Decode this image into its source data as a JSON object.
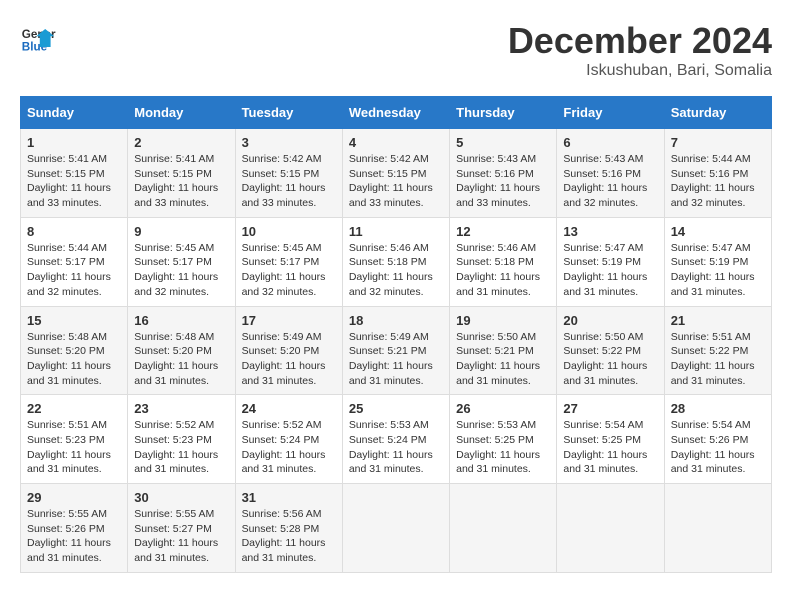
{
  "header": {
    "logo_line1": "General",
    "logo_line2": "Blue",
    "month": "December 2024",
    "location": "Iskushuban, Bari, Somalia"
  },
  "days_of_week": [
    "Sunday",
    "Monday",
    "Tuesday",
    "Wednesday",
    "Thursday",
    "Friday",
    "Saturday"
  ],
  "weeks": [
    [
      {
        "day": "1",
        "rise": "5:41 AM",
        "set": "5:15 PM",
        "hours": "11 hours and 33 minutes."
      },
      {
        "day": "2",
        "rise": "5:41 AM",
        "set": "5:15 PM",
        "hours": "11 hours and 33 minutes."
      },
      {
        "day": "3",
        "rise": "5:42 AM",
        "set": "5:15 PM",
        "hours": "11 hours and 33 minutes."
      },
      {
        "day": "4",
        "rise": "5:42 AM",
        "set": "5:15 PM",
        "hours": "11 hours and 33 minutes."
      },
      {
        "day": "5",
        "rise": "5:43 AM",
        "set": "5:16 PM",
        "hours": "11 hours and 33 minutes."
      },
      {
        "day": "6",
        "rise": "5:43 AM",
        "set": "5:16 PM",
        "hours": "11 hours and 32 minutes."
      },
      {
        "day": "7",
        "rise": "5:44 AM",
        "set": "5:16 PM",
        "hours": "11 hours and 32 minutes."
      }
    ],
    [
      {
        "day": "8",
        "rise": "5:44 AM",
        "set": "5:17 PM",
        "hours": "11 hours and 32 minutes."
      },
      {
        "day": "9",
        "rise": "5:45 AM",
        "set": "5:17 PM",
        "hours": "11 hours and 32 minutes."
      },
      {
        "day": "10",
        "rise": "5:45 AM",
        "set": "5:17 PM",
        "hours": "11 hours and 32 minutes."
      },
      {
        "day": "11",
        "rise": "5:46 AM",
        "set": "5:18 PM",
        "hours": "11 hours and 32 minutes."
      },
      {
        "day": "12",
        "rise": "5:46 AM",
        "set": "5:18 PM",
        "hours": "11 hours and 31 minutes."
      },
      {
        "day": "13",
        "rise": "5:47 AM",
        "set": "5:19 PM",
        "hours": "11 hours and 31 minutes."
      },
      {
        "day": "14",
        "rise": "5:47 AM",
        "set": "5:19 PM",
        "hours": "11 hours and 31 minutes."
      }
    ],
    [
      {
        "day": "15",
        "rise": "5:48 AM",
        "set": "5:20 PM",
        "hours": "11 hours and 31 minutes."
      },
      {
        "day": "16",
        "rise": "5:48 AM",
        "set": "5:20 PM",
        "hours": "11 hours and 31 minutes."
      },
      {
        "day": "17",
        "rise": "5:49 AM",
        "set": "5:20 PM",
        "hours": "11 hours and 31 minutes."
      },
      {
        "day": "18",
        "rise": "5:49 AM",
        "set": "5:21 PM",
        "hours": "11 hours and 31 minutes."
      },
      {
        "day": "19",
        "rise": "5:50 AM",
        "set": "5:21 PM",
        "hours": "11 hours and 31 minutes."
      },
      {
        "day": "20",
        "rise": "5:50 AM",
        "set": "5:22 PM",
        "hours": "11 hours and 31 minutes."
      },
      {
        "day": "21",
        "rise": "5:51 AM",
        "set": "5:22 PM",
        "hours": "11 hours and 31 minutes."
      }
    ],
    [
      {
        "day": "22",
        "rise": "5:51 AM",
        "set": "5:23 PM",
        "hours": "11 hours and 31 minutes."
      },
      {
        "day": "23",
        "rise": "5:52 AM",
        "set": "5:23 PM",
        "hours": "11 hours and 31 minutes."
      },
      {
        "day": "24",
        "rise": "5:52 AM",
        "set": "5:24 PM",
        "hours": "11 hours and 31 minutes."
      },
      {
        "day": "25",
        "rise": "5:53 AM",
        "set": "5:24 PM",
        "hours": "11 hours and 31 minutes."
      },
      {
        "day": "26",
        "rise": "5:53 AM",
        "set": "5:25 PM",
        "hours": "11 hours and 31 minutes."
      },
      {
        "day": "27",
        "rise": "5:54 AM",
        "set": "5:25 PM",
        "hours": "11 hours and 31 minutes."
      },
      {
        "day": "28",
        "rise": "5:54 AM",
        "set": "5:26 PM",
        "hours": "11 hours and 31 minutes."
      }
    ],
    [
      {
        "day": "29",
        "rise": "5:55 AM",
        "set": "5:26 PM",
        "hours": "11 hours and 31 minutes."
      },
      {
        "day": "30",
        "rise": "5:55 AM",
        "set": "5:27 PM",
        "hours": "11 hours and 31 minutes."
      },
      {
        "day": "31",
        "rise": "5:56 AM",
        "set": "5:28 PM",
        "hours": "11 hours and 31 minutes."
      },
      null,
      null,
      null,
      null
    ]
  ],
  "labels": {
    "sunrise": "Sunrise:",
    "sunset": "Sunset:",
    "daylight": "Daylight:"
  }
}
